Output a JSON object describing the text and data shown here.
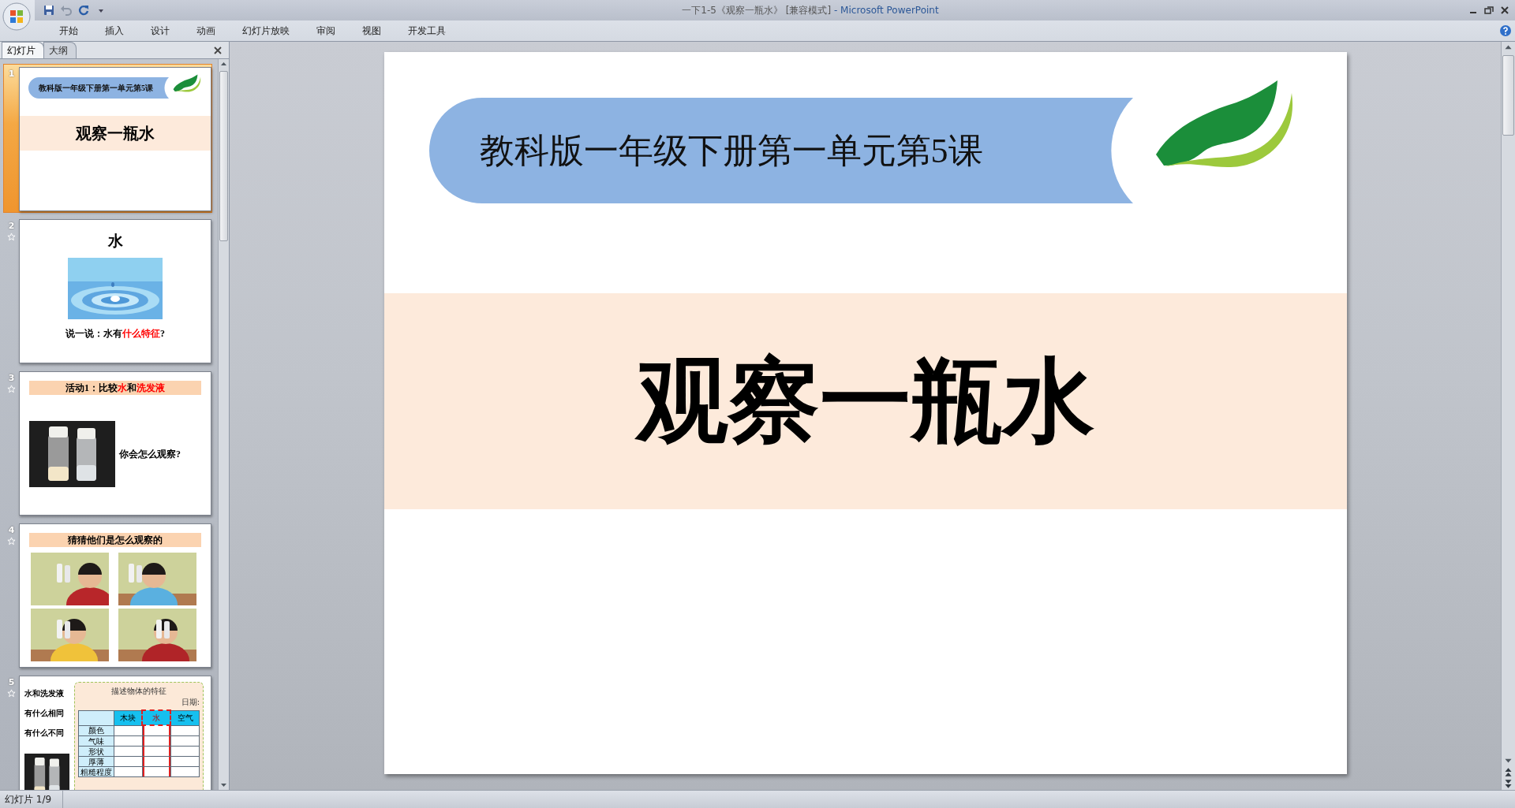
{
  "window": {
    "document": "一下1-5《观察一瓶水》 [兼容模式]",
    "application": "- Microsoft PowerPoint"
  },
  "ribbon_tabs": [
    {
      "label": "开始",
      "selected": false
    },
    {
      "label": "插入",
      "selected": false
    },
    {
      "label": "设计",
      "selected": false
    },
    {
      "label": "动画",
      "selected": false
    },
    {
      "label": "幻灯片放映",
      "selected": false
    },
    {
      "label": "审阅",
      "selected": false
    },
    {
      "label": "视图",
      "selected": false
    },
    {
      "label": "开发工具",
      "selected": false
    }
  ],
  "panel_tabs": [
    {
      "label": "幻灯片",
      "selected": true
    },
    {
      "label": "大纲",
      "selected": false
    }
  ],
  "thumbnails": [
    {
      "number": "1",
      "selected": true,
      "animated": false,
      "kind": "title",
      "banner": "教科版一年级下册第一单元第5课",
      "title": "观察一瓶水"
    },
    {
      "number": "2",
      "selected": false,
      "animated": true,
      "kind": "question",
      "heading": "水",
      "question": [
        {
          "text": "说一说：水有",
          "emphasis": false
        },
        {
          "text": "什么特征",
          "emphasis": true
        },
        {
          "text": "?",
          "emphasis": false
        }
      ]
    },
    {
      "number": "3",
      "selected": false,
      "animated": true,
      "kind": "activity",
      "heading": [
        {
          "text": "活动1：比较",
          "emphasis": false
        },
        {
          "text": "水",
          "emphasis": true
        },
        {
          "text": "和",
          "emphasis": false
        },
        {
          "text": "洗发液",
          "emphasis": true
        }
      ],
      "prompt": "你会怎么观察?"
    },
    {
      "number": "4",
      "selected": false,
      "animated": true,
      "kind": "photos",
      "heading": "猜猜他们是怎么观察的"
    },
    {
      "number": "5",
      "selected": false,
      "animated": true,
      "kind": "worksheet",
      "lines": [
        "水和洗发液",
        "有什么相同",
        "有什么不同"
      ],
      "worksheet": {
        "title": "描述物体的特征",
        "date_label": "日期:",
        "columns": [
          {
            "label": "木块",
            "highlighted": false
          },
          {
            "label": "水",
            "highlighted": true
          },
          {
            "label": "空气",
            "highlighted": false
          }
        ],
        "rows": [
          "颜色",
          "气味",
          "形状",
          "厚薄",
          "粗糙程度"
        ]
      }
    }
  ],
  "slide": {
    "banner": "教科版一年级下册第一单元第5课",
    "title": "观察一瓶水"
  },
  "status_bar": {
    "slide_position": "幻灯片 1/9"
  }
}
